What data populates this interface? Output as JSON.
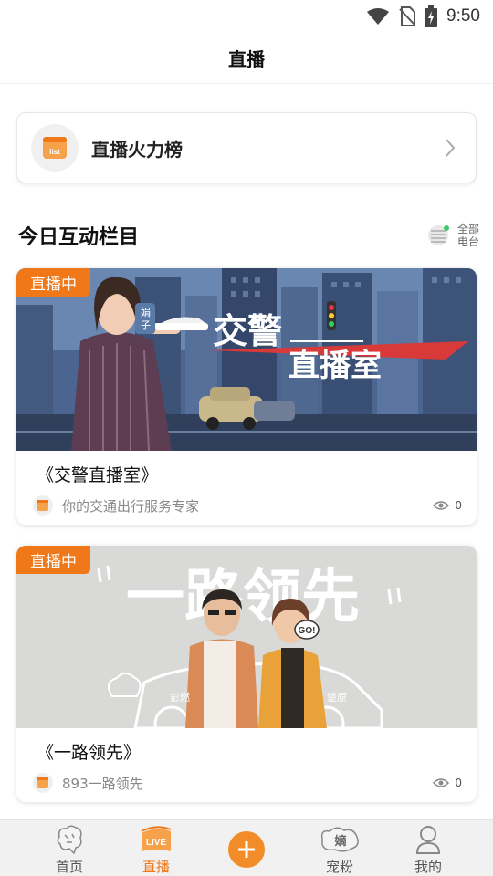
{
  "status_bar": {
    "time": "9:50"
  },
  "header": {
    "title": "直播"
  },
  "rank_card": {
    "label": "直播火力榜",
    "icon": "list-icon"
  },
  "section": {
    "title": "今日互动栏目",
    "all_stations_line1": "全部",
    "all_stations_line2": "电台"
  },
  "shows": [
    {
      "badge": "直播中",
      "title": "《交警直播室》",
      "subtitle": "你的交通出行服务专家",
      "views": "0",
      "banner_title_line1": "交警",
      "banner_title_line2": "直播室",
      "banner_host_name": "娟子"
    },
    {
      "badge": "直播中",
      "title": "《一路领先》",
      "subtitle": "893一路领先",
      "views": "0",
      "banner_title": "一路领先",
      "banner_host_left": "彭燃",
      "banner_host_right": "楚原",
      "banner_bubble": "GO!"
    }
  ],
  "tab_bar": {
    "tabs": [
      {
        "label": "首页",
        "icon": "home-icon"
      },
      {
        "label": "直播",
        "icon": "live-icon",
        "icon_text": "LIVE",
        "active": true
      },
      {
        "label": "",
        "icon": "add-icon"
      },
      {
        "label": "宠粉",
        "icon": "fans-icon",
        "icon_text": "嫡"
      },
      {
        "label": "我的",
        "icon": "profile-icon"
      }
    ]
  },
  "colors": {
    "accent": "#f07818",
    "background": "#ffffff"
  }
}
